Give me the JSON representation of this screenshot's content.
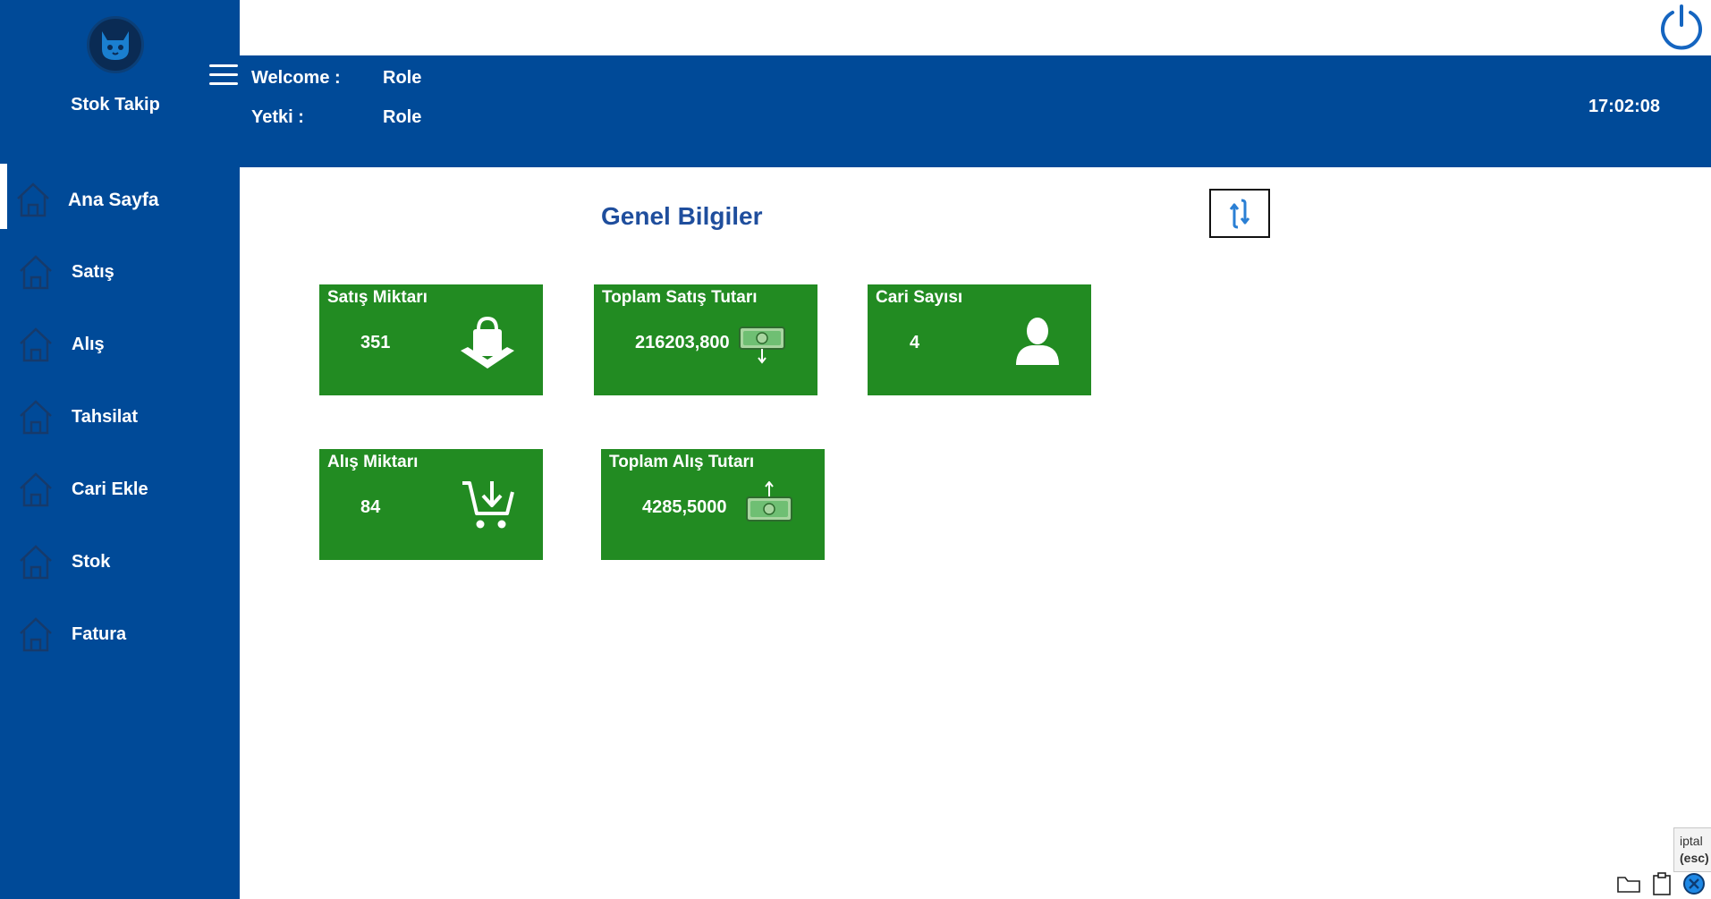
{
  "app": {
    "name": "Stok Takip"
  },
  "sidebar": {
    "items": [
      {
        "label": "Ana Sayfa",
        "icon": "home-icon",
        "active": true
      },
      {
        "label": "Satış",
        "icon": "home-icon"
      },
      {
        "label": "Alış",
        "icon": "home-icon"
      },
      {
        "label": "Tahsilat",
        "icon": "home-icon"
      },
      {
        "label": "Cari Ekle",
        "icon": "home-icon"
      },
      {
        "label": "Stok",
        "icon": "home-icon"
      },
      {
        "label": "Fatura",
        "icon": "home-icon"
      }
    ]
  },
  "header": {
    "welcome_label": "Welcome :",
    "welcome_value": "Role",
    "yetki_label": "Yetki :",
    "yetki_value": "Role",
    "time": "17:02:08"
  },
  "main": {
    "section_title": "Genel Bilgiler",
    "cards": [
      {
        "title": "Satış Miktarı",
        "value": "351",
        "icon": "shopping-bag-icon"
      },
      {
        "title": "Toplam Satış Tutarı",
        "value": "216203,800",
        "icon": "money-out-icon"
      },
      {
        "title": "Cari Sayısı",
        "value": "4",
        "icon": "user-icon"
      },
      {
        "title": "Alış Miktarı",
        "value": "84",
        "icon": "cart-download-icon"
      },
      {
        "title": "Toplam Alış Tutarı",
        "value": "4285,5000",
        "icon": "money-in-icon"
      }
    ]
  },
  "tooltip": {
    "line1": "iptal",
    "line2": "(esc)"
  },
  "colors": {
    "primary": "#004a98",
    "card": "#228b22",
    "title": "#1f4e9d",
    "power": "#1565c0"
  }
}
